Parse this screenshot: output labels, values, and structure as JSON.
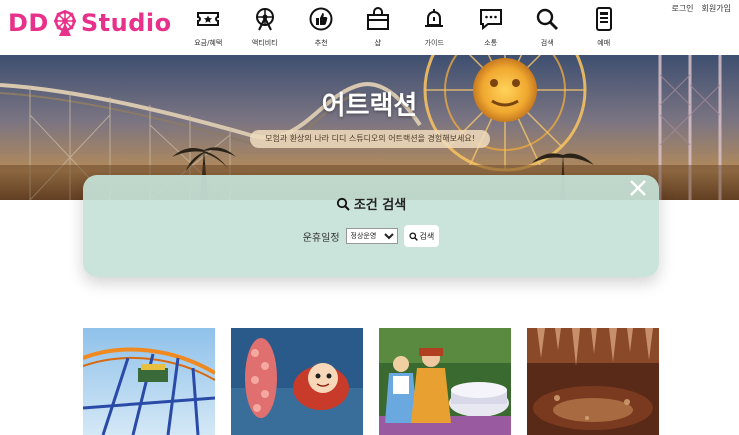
{
  "header": {
    "logo_prefix": "DD",
    "logo_suffix": "Studio",
    "nav": [
      {
        "label": "요금/혜택",
        "icon": "ticket-icon"
      },
      {
        "label": "액티비티",
        "icon": "ferris-wheel-icon"
      },
      {
        "label": "추천",
        "icon": "thumbs-up-icon"
      },
      {
        "label": "샵",
        "icon": "shop-icon"
      },
      {
        "label": "가이드",
        "icon": "bell-icon"
      },
      {
        "label": "소통",
        "icon": "chat-icon"
      },
      {
        "label": "검색",
        "icon": "search-icon"
      },
      {
        "label": "예매",
        "icon": "phone-icon"
      }
    ],
    "login": "로그인",
    "signup": "회원가입"
  },
  "hero": {
    "title": "어트랙션",
    "subtitle": "모험과 환상의 나라 디디 스튜디오의 어트랙션을 경험해보세요!"
  },
  "search_panel": {
    "title": "조건 검색",
    "filter_label": "운휴일정",
    "filter_selected": "정상운영",
    "search_button": "검색"
  },
  "colors": {
    "brand": "#e8318a",
    "panel": "#c5e2d8"
  }
}
